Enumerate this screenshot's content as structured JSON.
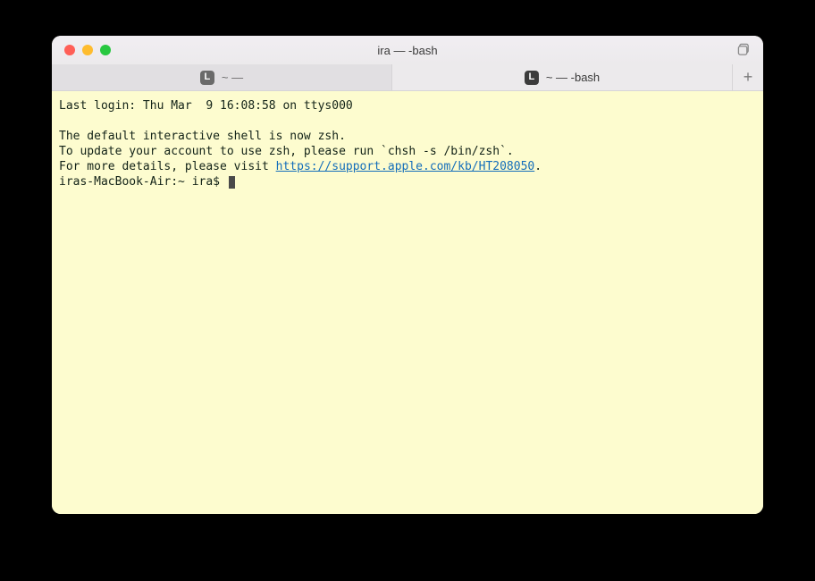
{
  "window": {
    "title": "ira — -bash"
  },
  "tabs": [
    {
      "icon": "L",
      "label": "~ — "
    },
    {
      "icon": "L",
      "label": "~ — -bash"
    }
  ],
  "terminal": {
    "last_login": "Last login: Thu Mar  9 16:08:58 on ttys000",
    "blank": "",
    "msg1": "The default interactive shell is now zsh.",
    "msg2": "To update your account to use zsh, please run `chsh -s /bin/zsh`.",
    "msg3_pre": "For more details, please visit ",
    "msg3_link": "https://support.apple.com/kb/HT208050",
    "msg3_post": ".",
    "prompt": "iras-MacBook-Air:~ ira$ "
  }
}
